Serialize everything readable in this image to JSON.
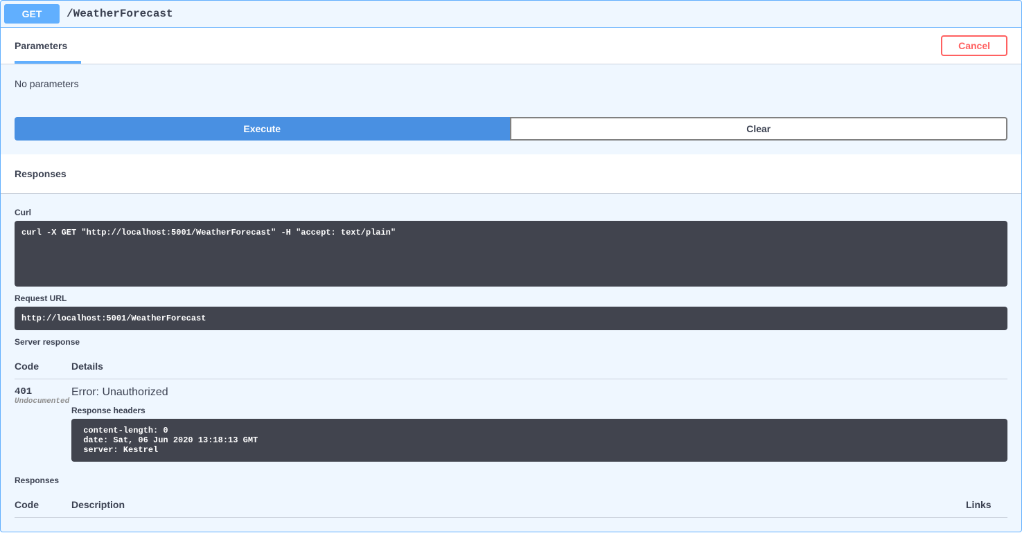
{
  "operation": {
    "method": "GET",
    "path": "/WeatherForecast"
  },
  "tabs": {
    "parameters": "Parameters",
    "cancel_label": "Cancel"
  },
  "parameters": {
    "empty_text": "No parameters"
  },
  "buttons": {
    "execute": "Execute",
    "clear": "Clear"
  },
  "responses": {
    "heading": "Responses",
    "curl_label": "Curl",
    "curl_command": "curl -X GET \"http://localhost:5001/WeatherForecast\" -H \"accept: text/plain\"",
    "request_url_label": "Request URL",
    "request_url": "http://localhost:5001/WeatherForecast",
    "server_response_label": "Server response",
    "table": {
      "code_header": "Code",
      "details_header": "Details",
      "description_header": "Description",
      "links_header": "Links"
    },
    "live": {
      "code": "401",
      "undocumented": "Undocumented",
      "error": "Error: Unauthorized",
      "headers_label": "Response headers",
      "headers": " content-length: 0 \n date: Sat, 06 Jun 2020 13:18:13 GMT \n server: Kestrel "
    },
    "responses_sub_label": "Responses"
  }
}
